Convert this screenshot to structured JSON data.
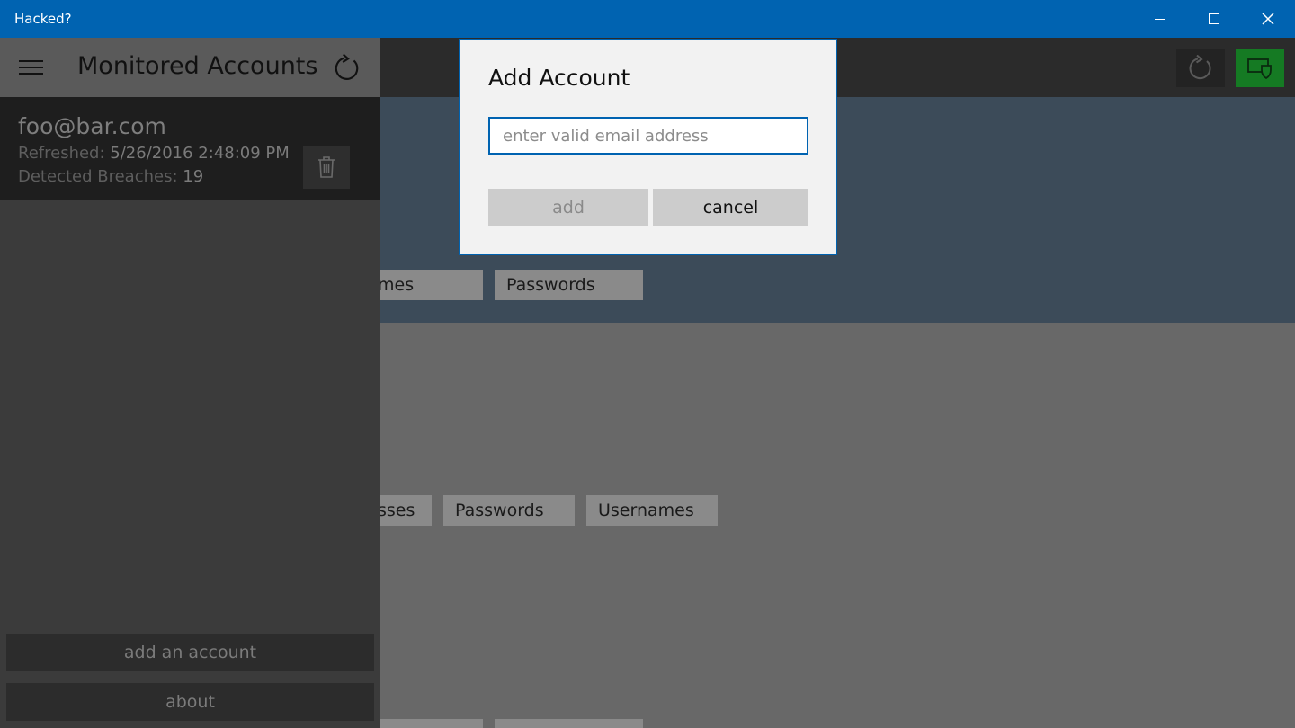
{
  "window": {
    "title": "Hacked?",
    "controls": [
      "minimize",
      "maximize",
      "close"
    ]
  },
  "colors": {
    "titlebar": "#0063b1",
    "accent_green": "#157a23",
    "hero": "#3c4b59"
  },
  "app_bar": {
    "icons": [
      "refresh-icon",
      "shield-icon"
    ]
  },
  "hero": {
    "buttons": [
      "mes",
      "Passwords"
    ]
  },
  "content": {
    "buttons": [
      "sses",
      "Passwords",
      "Usernames"
    ]
  },
  "left_pane": {
    "title": "Monitored Accounts",
    "accounts": [
      {
        "email": "foo@bar.com",
        "refreshed_label": "Refreshed:",
        "refreshed_value": "5/26/2016 2:48:09 PM",
        "breaches_label": "Detected Breaches:",
        "breaches_value": "19"
      }
    ],
    "add_account_label": "add an account",
    "about_label": "about"
  },
  "dialog": {
    "title": "Add Account",
    "email_placeholder": "enter valid email address",
    "email_value": "",
    "add_label": "add",
    "cancel_label": "cancel"
  }
}
